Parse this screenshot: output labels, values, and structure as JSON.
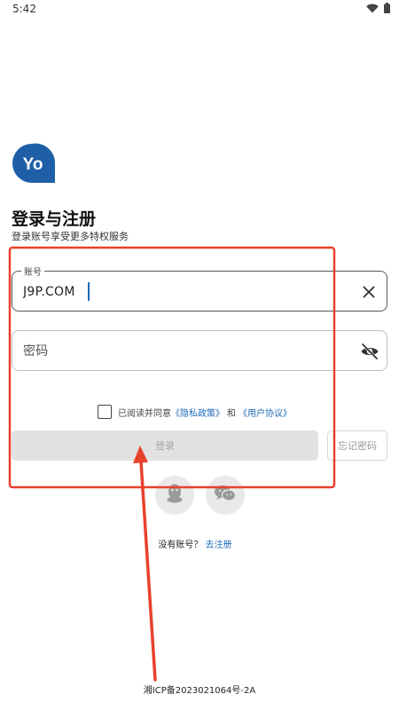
{
  "status_bar": {
    "time": "5:42",
    "wifi_icon": "wifi-icon",
    "battery_icon": "battery-icon"
  },
  "logo": {
    "text": "Yo",
    "color": "#1e5fa8"
  },
  "header": {
    "title": "登录与注册",
    "subtitle": "登录账号享受更多特权服务"
  },
  "account_field": {
    "label": "账号",
    "value": "J9P.COM",
    "clear_icon": "close-icon"
  },
  "password_field": {
    "placeholder": "密码",
    "toggle_icon": "eye-off-icon"
  },
  "agreement": {
    "prefix": "已阅读并同意",
    "privacy_link": "《隐私政策》",
    "and": "和",
    "terms_link": "《用户协议》",
    "checked": false
  },
  "buttons": {
    "login": "登录",
    "forgot_password": "忘记密码"
  },
  "social_login": {
    "qq_icon": "qq-icon",
    "wechat_icon": "wechat-icon"
  },
  "register": {
    "prompt": "没有账号？",
    "link": "去注册"
  },
  "footer": {
    "icp": "湘ICP备2023021064号-2A"
  },
  "colors": {
    "accent": "#1e6ab8",
    "annotation": "#e8412c",
    "disabled_button": "#e2e2e2"
  }
}
